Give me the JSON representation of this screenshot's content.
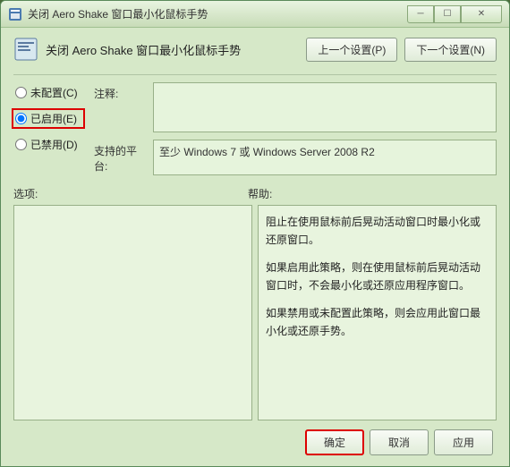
{
  "window": {
    "title": "关闭 Aero Shake 窗口最小化鼠标手势"
  },
  "header": {
    "policy_title": "关闭 Aero Shake 窗口最小化鼠标手势",
    "prev_button": "上一个设置(P)",
    "next_button": "下一个设置(N)"
  },
  "radios": {
    "not_configured": "未配置(C)",
    "enabled": "已启用(E)",
    "disabled": "已禁用(D)",
    "selected": "enabled"
  },
  "fields": {
    "comment_label": "注释:",
    "comment_value": "",
    "platform_label": "支持的平台:",
    "platform_value": "至少 Windows 7 或 Windows Server 2008 R2"
  },
  "labels": {
    "options": "选项:",
    "help": "帮助:"
  },
  "help": {
    "p1": "阻止在使用鼠标前后晃动活动窗口时最小化或还原窗口。",
    "p2": "如果启用此策略，则在使用鼠标前后晃动活动窗口时，不会最小化或还原应用程序窗口。",
    "p3": "如果禁用或未配置此策略，则会应用此窗口最小化或还原手势。"
  },
  "footer": {
    "ok": "确定",
    "cancel": "取消",
    "apply": "应用"
  }
}
